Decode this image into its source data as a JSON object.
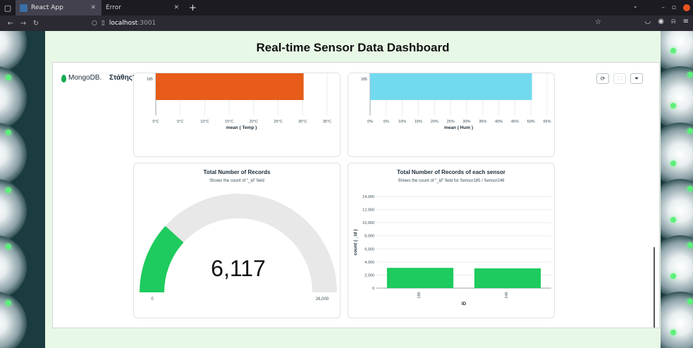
{
  "browser": {
    "tabs": [
      {
        "label": "React App",
        "active": true
      },
      {
        "label": "Error",
        "active": false
      }
    ],
    "url_host": "localhost",
    "url_port": ":3001"
  },
  "page": {
    "title": "Real-time Sensor Data Dashboard"
  },
  "dashboard": {
    "brand": "MongoDB.",
    "name": "Στάθης's Dashboard"
  },
  "colors": {
    "temp_bar": "#e65c18",
    "hum_bar": "#73d9ef",
    "green": "#1ecb5e",
    "gauge_bg": "#e8e8e8"
  },
  "charts": {
    "temp": {
      "category_label": "185",
      "xlabel": "mean ( Temp )",
      "ticks": [
        "0°C",
        "5°C",
        "10°C",
        "15°C",
        "20°C",
        "25°C",
        "30°C",
        "35°C"
      ]
    },
    "hum": {
      "category_label": "185",
      "xlabel": "mean ( Hum )",
      "ticks": [
        "0%",
        "5%",
        "10%",
        "15%",
        "20%",
        "25%",
        "30%",
        "35%",
        "40%",
        "45%",
        "50%",
        "55%"
      ]
    },
    "gauge": {
      "title": "Total Number of Records",
      "subtitle": "Shows the count of \"_id\" field",
      "value_label": "6,117",
      "min_label": "0",
      "max_label": "26,000"
    },
    "bars": {
      "title": "Total Number of Records of each sensor",
      "subtitle": "Shows the count of \"_id\" field for Sensor185 / Sensor246",
      "ylabel": "count ( _id )",
      "xlabel": "ID",
      "yticks": [
        "0",
        "2,000",
        "4,000",
        "6,000",
        "8,000",
        "10,000",
        "12,000",
        "14,000"
      ],
      "categories": [
        "185",
        "246"
      ]
    }
  },
  "chart_data": [
    {
      "type": "bar",
      "orientation": "horizontal",
      "categories": [
        "185"
      ],
      "values": [
        30.2
      ],
      "xlabel": "mean ( Temp )",
      "xlim": [
        0,
        35
      ],
      "unit": "°C"
    },
    {
      "type": "bar",
      "orientation": "horizontal",
      "categories": [
        "185"
      ],
      "values": [
        50.3
      ],
      "xlabel": "mean ( Hum )",
      "xlim": [
        0,
        55
      ],
      "unit": "%"
    },
    {
      "type": "gauge",
      "title": "Total Number of Records",
      "subtitle": "Shows the count of \"_id\" field",
      "value": 6117,
      "min": 0,
      "max": 26000
    },
    {
      "type": "bar",
      "title": "Total Number of Records of each sensor",
      "subtitle": "Shows the count of \"_id\" field for Sensor185 / Sensor246",
      "categories": [
        "185",
        "246"
      ],
      "values": [
        3100,
        3017
      ],
      "xlabel": "ID",
      "ylabel": "count ( _id )",
      "ylim": [
        0,
        14000
      ]
    }
  ]
}
